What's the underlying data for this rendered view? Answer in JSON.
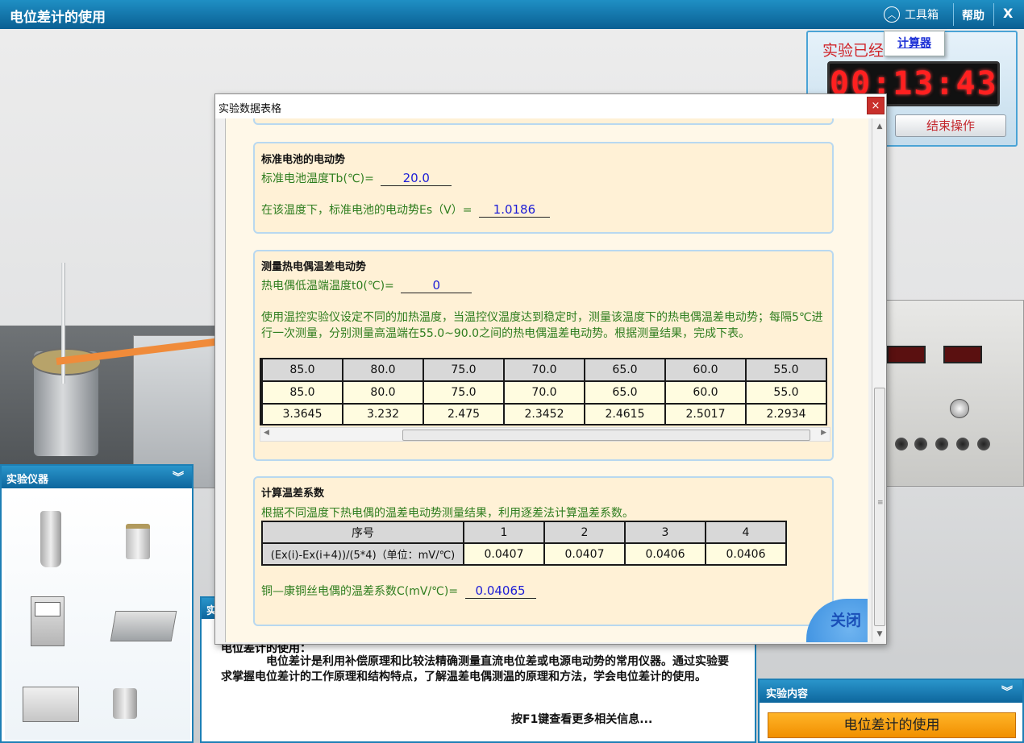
{
  "window": {
    "title": "电位差计的使用",
    "toolbox": "工具箱",
    "help": "帮助",
    "close": "X"
  },
  "toolbox_menu": {
    "calculator": "计算器"
  },
  "timer": {
    "label": "实验已经",
    "time": "00:13:43",
    "end_button": "结束操作"
  },
  "instruments": {
    "title": "实验仪器"
  },
  "description": {
    "title": "实",
    "heading": "电位差计的使用：",
    "body": "电位差计是利用补偿原理和比较法精确测量直流电位差或电源电动势的常用仪器。通过实验要求掌握电位差计的工作原理和结构特点，了解温差电偶测温的原理和方法，学会电位差计的使用。",
    "hint": "按F1键查看更多相关信息..."
  },
  "content_panel": {
    "title": "实验内容",
    "item": "电位差计的使用"
  },
  "dialog": {
    "title": "实验数据表格",
    "close": "×",
    "section1": {
      "title": "标准电池的电动势",
      "temp_label": "标准电池温度Tb(℃)=",
      "temp_value": "20.0",
      "emf_label": "在该温度下，标准电池的电动势Es（V）=",
      "emf_value": "1.0186"
    },
    "section2": {
      "title": "测量热电偶温差电动势",
      "low_label": "热电偶低温端温度t0(℃)=",
      "low_value": "0",
      "instructions": "使用温控实验仪设定不同的加热温度，当温控仪温度达到稳定时，测量该温度下的热电偶温差电动势；每隔5℃进行一次测量，分别测量高温端在55.0~90.0之间的热电偶温差电动势。根据测量结果，完成下表。",
      "row_headers": [
        "85.0",
        "80.0",
        "75.0",
        "70.0",
        "65.0",
        "60.0",
        "55.0"
      ],
      "row_temps": [
        "85.0",
        "80.0",
        "75.0",
        "70.0",
        "65.0",
        "60.0",
        "55.0"
      ],
      "row_emf": [
        "3.3645",
        "3.232",
        "2.475",
        "2.3452",
        "2.4615",
        "2.5017",
        "2.2934"
      ]
    },
    "section3": {
      "title": "计算温差系数",
      "instructions": "根据不同温度下热电偶的温差电动势测量结果，利用逐差法计算温差系数。",
      "col_header": "序号",
      "cols": [
        "1",
        "2",
        "3",
        "4"
      ],
      "row_label": "(Ex(i)-Ex(i+4))/(5*4)（单位：mV/℃)",
      "row_values": [
        "0.0407",
        "0.0407",
        "0.0406",
        "0.0406"
      ],
      "coef_label": "铜—康铜丝电偶的温差系数C(mV/℃)=",
      "coef_value": "0.04065"
    },
    "close_button": "关闭"
  }
}
